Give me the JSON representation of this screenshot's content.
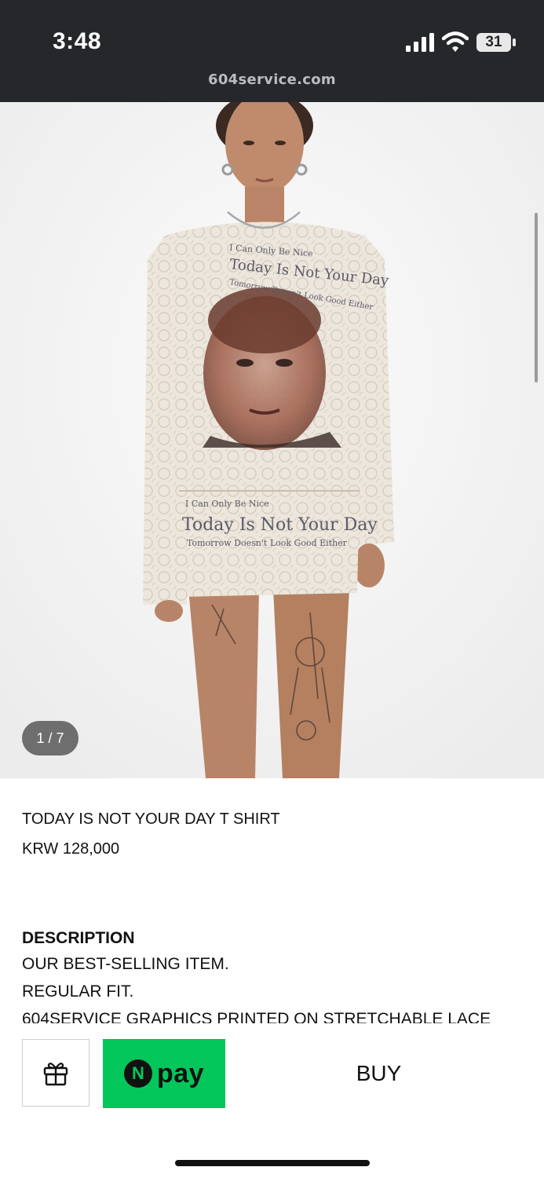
{
  "status_bar": {
    "time": "3:48",
    "url": "604service.com",
    "battery": "31"
  },
  "gallery": {
    "counter": "1 / 7",
    "image_text": {
      "line1": "I Can Only Be Nice",
      "line2": "Today Is Not Your Day",
      "line3": "Tomorrow Doesn't Look Good Either"
    }
  },
  "product": {
    "name": "TODAY IS NOT YOUR DAY T SHIRT",
    "price": "KRW 128,000"
  },
  "description": {
    "heading": "DESCRIPTION",
    "lines": [
      "OUR BEST-SELLING ITEM.",
      "REGULAR FIT.",
      "604SERVICE GRAPHICS PRINTED ON STRETCHABLE LACE"
    ]
  },
  "actions": {
    "npay_n": "N",
    "npay_label": "pay",
    "buy_label": "BUY",
    "npay_color": "#03c75a"
  },
  "icons": [
    "signal-icon",
    "wifi-icon",
    "battery-icon",
    "gift-icon"
  ]
}
